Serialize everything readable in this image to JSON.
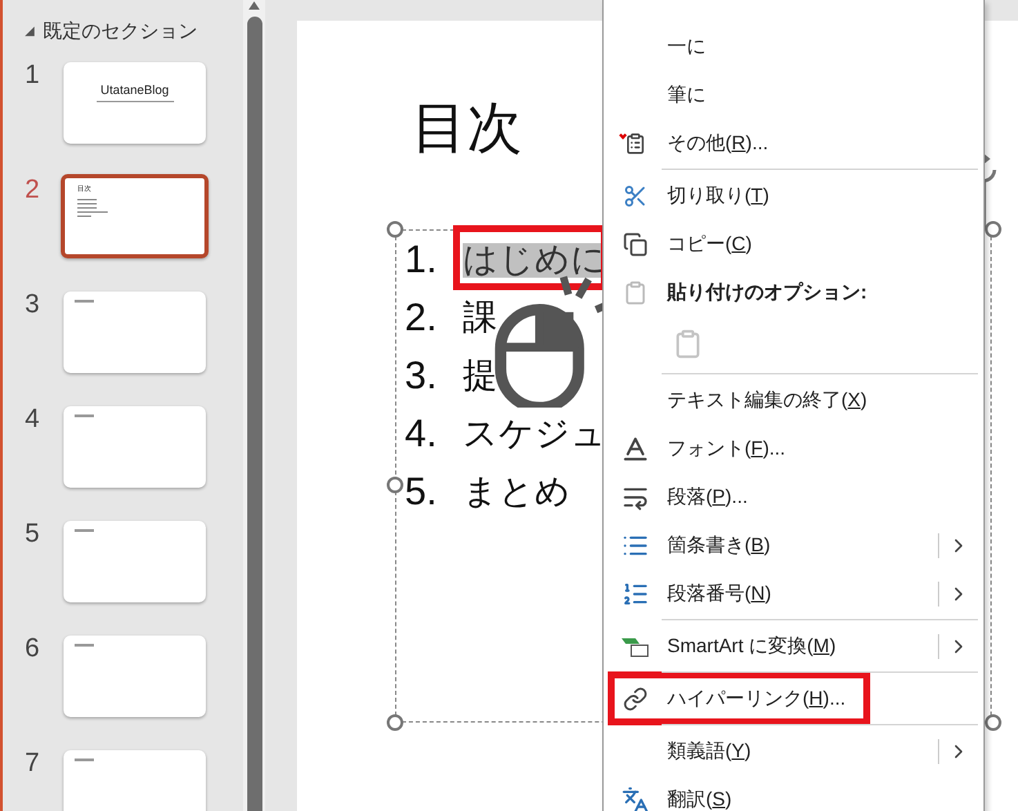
{
  "sidebar": {
    "section": {
      "arrow": "◢",
      "label": "既定のセクション"
    },
    "slides": [
      {
        "number": "1",
        "selected": false,
        "kind": "title",
        "title": "UtataneBlog"
      },
      {
        "number": "2",
        "selected": true,
        "kind": "list",
        "title": "目次"
      },
      {
        "number": "3",
        "selected": false,
        "kind": "heading"
      },
      {
        "number": "4",
        "selected": false,
        "kind": "heading"
      },
      {
        "number": "5",
        "selected": false,
        "kind": "heading"
      },
      {
        "number": "6",
        "selected": false,
        "kind": "heading"
      },
      {
        "number": "7",
        "selected": false,
        "kind": "heading"
      }
    ]
  },
  "slide": {
    "title": "目次",
    "items": [
      {
        "number": "1.",
        "text": "はじめに",
        "selected": true
      },
      {
        "number": "2.",
        "text": "課",
        "selected": false
      },
      {
        "number": "3.",
        "text": "提",
        "selected": false
      },
      {
        "number": "4.",
        "text": "スケジュ",
        "selected": false
      },
      {
        "number": "5.",
        "text": "まとめ",
        "selected": false
      }
    ]
  },
  "context_menu": {
    "items": [
      {
        "kind": "item",
        "before": "一に",
        "submenu": false
      },
      {
        "kind": "item",
        "before": "筆に",
        "submenu": false
      },
      {
        "kind": "item",
        "before": "その他(",
        "key": "R",
        "after": ")...",
        "submenu": false
      },
      {
        "kind": "separator"
      },
      {
        "kind": "item",
        "before": "切り取り(",
        "key": "T",
        "after": ")",
        "submenu": false
      },
      {
        "kind": "item",
        "before": "コピー(",
        "key": "C",
        "after": ")",
        "submenu": false
      },
      {
        "kind": "header",
        "before": "貼り付けのオプション:"
      },
      {
        "kind": "paste"
      },
      {
        "kind": "separator"
      },
      {
        "kind": "item",
        "before": "テキスト編集の終了(",
        "key": "X",
        "after": ")",
        "submenu": false
      },
      {
        "kind": "item",
        "before": "フォント(",
        "key": "F",
        "after": ")...",
        "submenu": false
      },
      {
        "kind": "item",
        "before": "段落(",
        "key": "P",
        "after": ")...",
        "submenu": false
      },
      {
        "kind": "item",
        "before": "箇条書き(",
        "key": "B",
        "after": ")",
        "submenu": true
      },
      {
        "kind": "item",
        "before": "段落番号(",
        "key": "N",
        "after": ")",
        "submenu": true
      },
      {
        "kind": "separator"
      },
      {
        "kind": "item",
        "before": "SmartArt に変換(",
        "key": "M",
        "after": ")",
        "submenu": true
      },
      {
        "kind": "separator"
      },
      {
        "kind": "item",
        "before": "ハイパーリンク(",
        "key": "H",
        "after": ")...",
        "submenu": false
      },
      {
        "kind": "separator"
      },
      {
        "kind": "item",
        "before": "類義語(",
        "key": "Y",
        "after": ")",
        "submenu": true
      },
      {
        "kind": "item",
        "before": "翻訳(",
        "key": "S",
        "after": ")",
        "submenu": false
      }
    ]
  }
}
